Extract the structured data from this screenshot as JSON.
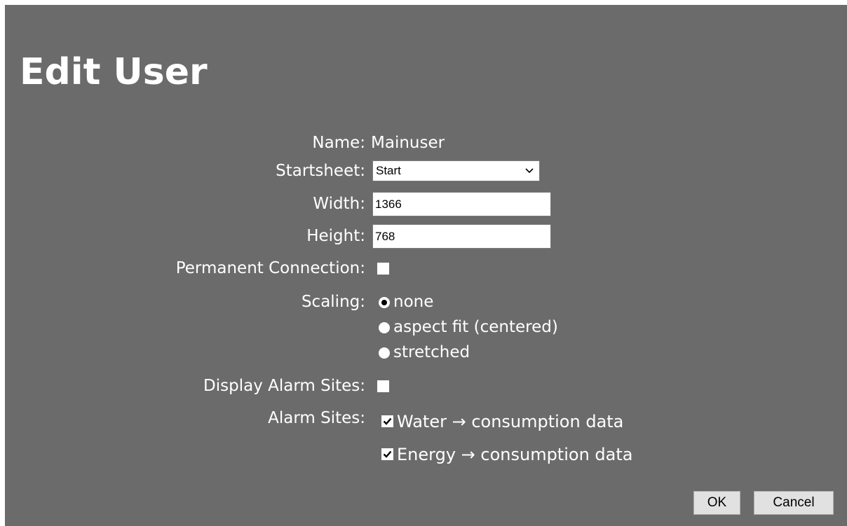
{
  "dialog": {
    "title": "Edit User"
  },
  "fields": {
    "name": {
      "label": "Name:",
      "value": "Mainuser"
    },
    "startsheet": {
      "label": "Startsheet:",
      "value": "Start"
    },
    "width": {
      "label": "Width:",
      "value": "1366"
    },
    "height": {
      "label": "Height:",
      "value": "768"
    },
    "permanent_connection": {
      "label": "Permanent Connection:",
      "checked": false
    },
    "scaling": {
      "label": "Scaling:",
      "options": [
        {
          "label": "none",
          "selected": true
        },
        {
          "label": "aspect fit (centered)",
          "selected": false
        },
        {
          "label": "stretched",
          "selected": false
        }
      ]
    },
    "display_alarm_sites": {
      "label": "Display Alarm Sites:",
      "checked": false
    },
    "alarm_sites": {
      "label": "Alarm Sites:",
      "items": [
        {
          "label": "Water → consumption data",
          "checked": true
        },
        {
          "label": "Energy → consumption data",
          "checked": true
        }
      ]
    }
  },
  "buttons": {
    "ok": "OK",
    "cancel": "Cancel"
  },
  "colors": {
    "background": "#6b6b6b",
    "text": "#ffffff",
    "button_face": "#e1e1e1"
  }
}
